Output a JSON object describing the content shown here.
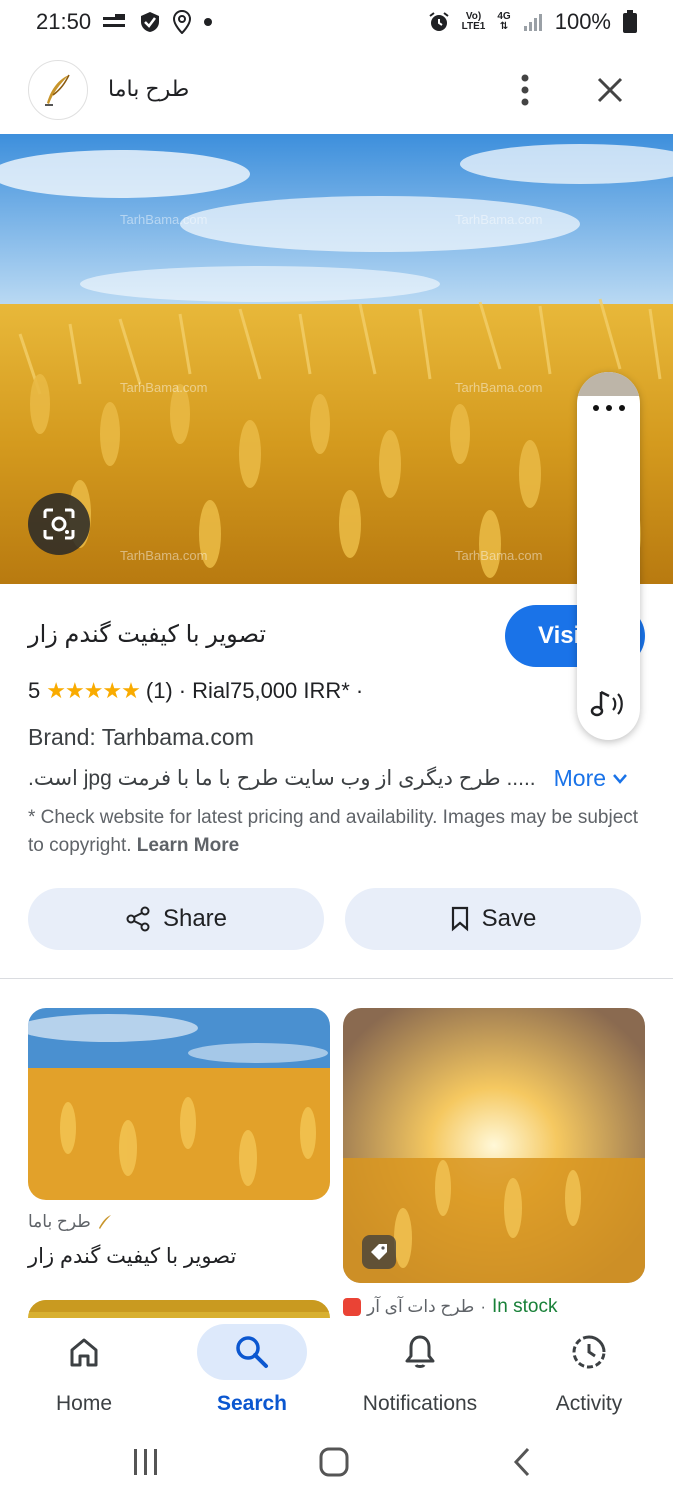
{
  "status_bar": {
    "time": "21:50",
    "network_top": "Vo)",
    "network_bottom": "LTE1",
    "data_type": "4G",
    "battery": "100%"
  },
  "top_bar": {
    "site_name": "طرح باما"
  },
  "hero": {
    "watermark": "TarhBama.com"
  },
  "product": {
    "title": "تصویر با کیفیت گندم زار",
    "visit_label": "Visit",
    "rating_value": "5",
    "stars": "★★★★★",
    "rating_count": "(1)",
    "separator": "·",
    "price": "Rial75,000 IRR*",
    "separator2": "·",
    "brand": "Brand: Tarhbama.com",
    "description": "..... طرح دیگری از وب سایت طرح با ما با فرمت jpg است.",
    "more_label": "More",
    "disclaimer": "* Check website for latest pricing and availability. Images may be subject to copyright.",
    "learn_more": "Learn More"
  },
  "actions": {
    "share_label": "Share",
    "save_label": "Save"
  },
  "results": [
    {
      "source": "طرح باما",
      "title": "تصویر با کیفیت گندم زار"
    },
    {
      "source": "طرح دات آی آر",
      "stock": "In stock",
      "separator": "·"
    }
  ],
  "bottom_nav": {
    "items": [
      {
        "label": "Home",
        "icon": "home-icon"
      },
      {
        "label": "Search",
        "icon": "search-icon",
        "active": true
      },
      {
        "label": "Notifications",
        "icon": "bell-icon"
      },
      {
        "label": "Activity",
        "icon": "activity-icon"
      }
    ]
  },
  "colors": {
    "accent": "#1a73e8",
    "stars": "#f9ab00",
    "in_stock": "#188038",
    "action_bg": "#e8eef9"
  }
}
